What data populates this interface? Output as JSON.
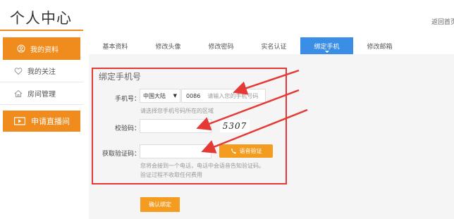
{
  "header": {
    "title": "个人中心",
    "top_link": "返回首页"
  },
  "sidebar": {
    "items": [
      {
        "label": "我的资料",
        "icon": "user-icon",
        "active": true
      },
      {
        "label": "我的关注",
        "icon": "heart-icon",
        "active": false
      },
      {
        "label": "房间管理",
        "icon": "home-icon",
        "active": false
      }
    ],
    "live_button": {
      "label": "申请直播间",
      "icon": "video-icon"
    }
  },
  "tabs": [
    {
      "label": "基本资料",
      "active": false
    },
    {
      "label": "修改头像",
      "active": false
    },
    {
      "label": "修改密码",
      "active": false
    },
    {
      "label": "实名认证",
      "active": false
    },
    {
      "label": "绑定手机",
      "active": true
    },
    {
      "label": "修改邮箱",
      "active": false
    }
  ],
  "form": {
    "title": "绑定手机号",
    "phone": {
      "label": "手机号：",
      "region": "中国大陆",
      "code": "0086",
      "placeholder": "请输入您的手机号码",
      "hint": "请选择您手机号码所在的区域"
    },
    "captcha": {
      "label": "校验码：",
      "image_text": "5307"
    },
    "verify": {
      "label": "获取验证码：",
      "voice_button": "语音验证",
      "hint_line1": "您将会接到一个电话，电话中会语音告知验证码。",
      "hint_line2": "验证过程不收取任何费用"
    },
    "confirm_button": "确认绑定"
  },
  "colors": {
    "accent": "#f08c1e",
    "tab_active": "#3a8ee6",
    "annotation": "#e53935"
  }
}
